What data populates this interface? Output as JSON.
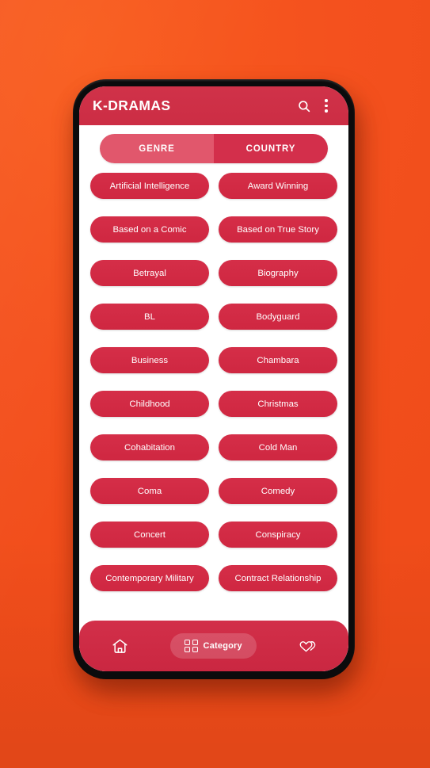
{
  "theme": {
    "background_orange": "#f4511e",
    "brand_red": "#ce2f47",
    "chip_red": "#d32b45",
    "segment_active": "#e1576c",
    "segment_inactive": "#d32f4b",
    "text_on_brand": "#ffffff",
    "phone_bezel": "#0b0b0c"
  },
  "app_bar": {
    "title": "K-DRAMAS",
    "search_icon": "search-icon",
    "overflow_icon": "overflow-menu-icon"
  },
  "segmented_control": {
    "selected": "GENRE",
    "options": [
      {
        "label": "GENRE",
        "active": true
      },
      {
        "label": "COUNTRY",
        "active": false
      }
    ]
  },
  "chips": [
    "Artificial Intelligence",
    "Award Winning",
    "Based on a Comic",
    "Based on True Story",
    "Betrayal",
    "Biography",
    "BL",
    "Bodyguard",
    "Business",
    "Chambara",
    "Childhood",
    "Christmas",
    "Cohabitation",
    "Cold Man",
    "Coma",
    "Comedy",
    "Concert",
    "Conspiracy",
    "Contemporary Military",
    "Contract Relationship"
  ],
  "bottom_nav": {
    "items": [
      {
        "id": "home",
        "label": "",
        "icon": "home-icon",
        "active": false
      },
      {
        "id": "category",
        "label": "Category",
        "icon": "grid-icon",
        "active": true
      },
      {
        "id": "favorites",
        "label": "",
        "icon": "double-heart-icon",
        "active": false
      }
    ],
    "category_label": "Category"
  }
}
